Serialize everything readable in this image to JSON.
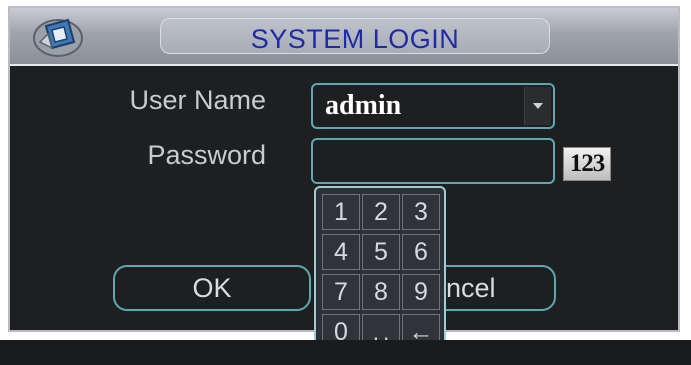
{
  "dialog": {
    "title": "SYSTEM LOGIN",
    "icon": "camera-logo-icon"
  },
  "form": {
    "user_name_label": "User Name",
    "user_name_value": "admin",
    "password_label": "Password",
    "password_value": "",
    "input_mode_button": "123"
  },
  "buttons": {
    "ok": "OK",
    "cancel": "ncel"
  },
  "keypad": {
    "keys": [
      "1",
      "2",
      "3",
      "4",
      "5",
      "6",
      "7",
      "8",
      "9",
      "0",
      "␣",
      "←"
    ]
  },
  "colors": {
    "title_text": "#1f2aa8",
    "field_border": "#5fa7b4",
    "dialog_background": "#1d1f21"
  }
}
